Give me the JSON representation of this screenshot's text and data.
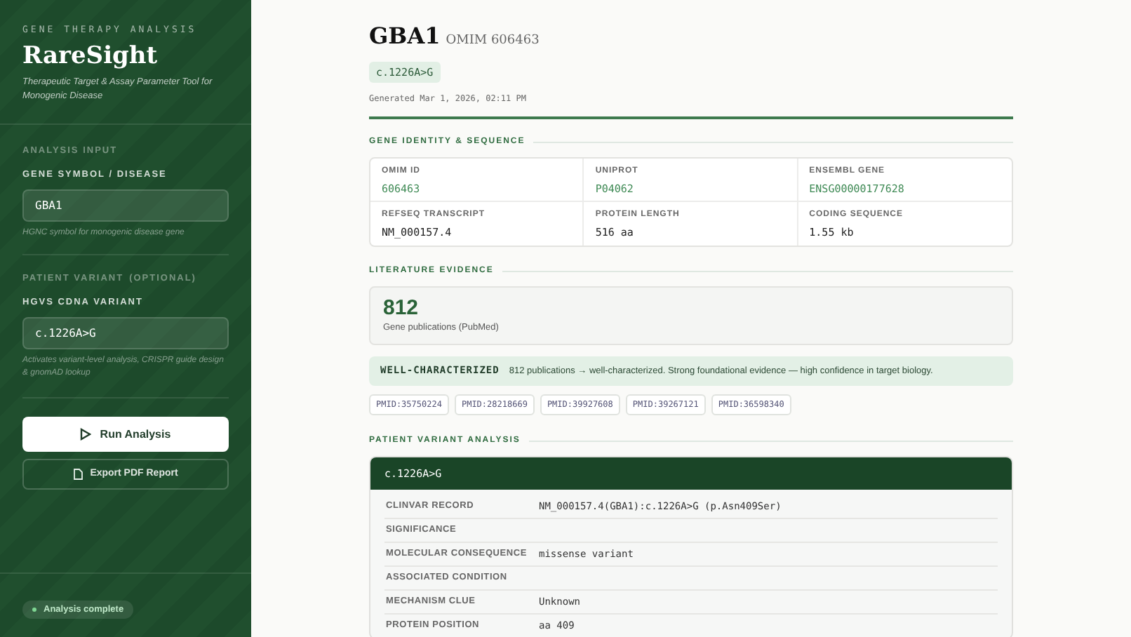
{
  "sidebar": {
    "eyebrow": "GENE THERAPY ANALYSIS",
    "title": "RareSight",
    "subtitle": "Therapeutic Target & Assay Parameter Tool for Monogenic Disease",
    "section_label": "ANALYSIS INPUT",
    "fields": [
      {
        "label": "GENE SYMBOL / DISEASE",
        "value": "GBA1",
        "hint": "HGNC symbol for monogenic disease gene"
      },
      {
        "group_label": "PATIENT VARIANT",
        "group_note": "(OPTIONAL)",
        "label": "HGVS CDNA VARIANT",
        "value": "c.1226A>G",
        "hint": "Activates variant-level analysis, CRISPR guide design & gnomAD lookup"
      }
    ],
    "buttons": [
      {
        "kind": "primary",
        "label": "Run Analysis"
      },
      {
        "kind": "secondary",
        "label": "Export PDF Report"
      }
    ],
    "status": "Analysis complete"
  },
  "header": {
    "gene": "GBA1",
    "omim": "OMIM 606463",
    "variant_badge": "c.1226A>G",
    "generated": "Generated Mar 1, 2026, 02:11 PM"
  },
  "identity": {
    "heading": "GENE IDENTITY & SEQUENCE",
    "cells": [
      {
        "label": "OMIM ID",
        "value": "606463",
        "kind": "link"
      },
      {
        "label": "UNIPROT",
        "value": "P04062",
        "kind": "link"
      },
      {
        "label": "ENSEMBL GENE",
        "value": "ENSG00000177628",
        "kind": "link"
      },
      {
        "label": "REFSEQ TRANSCRIPT",
        "value": "NM_000157.4",
        "kind": "plain"
      },
      {
        "label": "PROTEIN LENGTH",
        "value": "516 aa",
        "kind": "plain"
      },
      {
        "label": "CODING SEQUENCE",
        "value": "1.55 kb",
        "kind": "plain"
      }
    ]
  },
  "literature": {
    "heading": "LITERATURE EVIDENCE",
    "count": "812",
    "count_label": "Gene publications (PubMed)",
    "verdict": "WELL-CHARACTERIZED",
    "verdict_text": "812 publications → well-characterized. Strong foundational evidence — high confidence in target biology.",
    "pmids": [
      "PMID:35750224",
      "PMID:28218669",
      "PMID:39927608",
      "PMID:39267121",
      "PMID:36598340"
    ]
  },
  "variant": {
    "heading": "PATIENT VARIANT ANALYSIS",
    "title": "c.1226A>G",
    "rows": [
      {
        "label": "CLINVAR RECORD",
        "value": "NM_000157.4(GBA1):c.1226A>G (p.Asn409Ser)"
      },
      {
        "label": "SIGNIFICANCE"
      },
      {
        "label": "MOLECULAR CONSEQUENCE",
        "value": "missense variant"
      },
      {
        "label": "ASSOCIATED CONDITION"
      },
      {
        "label": "MECHANISM CLUE",
        "value": "Unknown"
      },
      {
        "label": "PROTEIN POSITION",
        "value": "aa 409"
      }
    ]
  }
}
